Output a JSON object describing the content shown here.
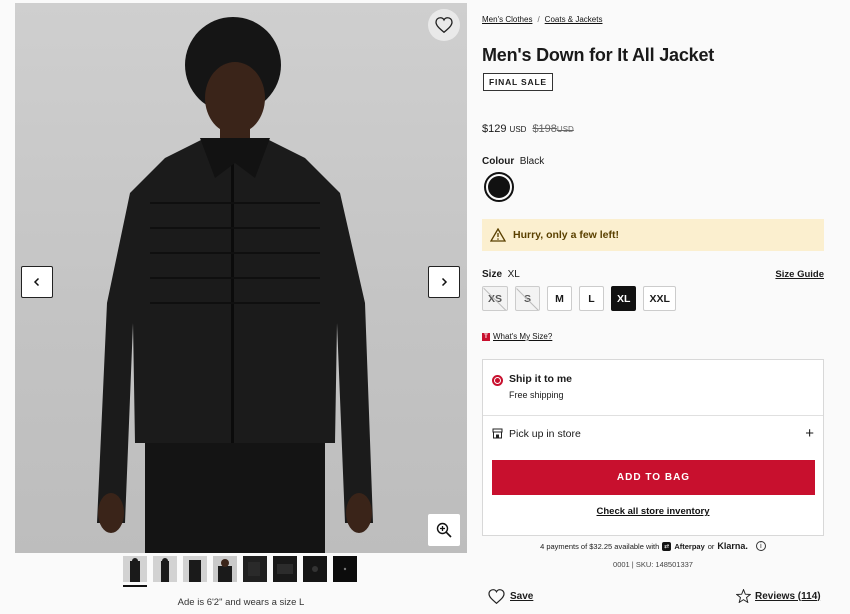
{
  "gallery": {
    "caption": "Ade is 6'2\" and wears a size L",
    "thumbnail_count": 8
  },
  "breadcrumb": [
    "Men's Clothes",
    "Coats & Jackets"
  ],
  "breadcrumb_sep": "/",
  "product": {
    "title": "Men's Down for It All Jacket",
    "badge": "FINAL SALE",
    "price": "$129",
    "price_currency": "USD",
    "original_price": "$198",
    "original_currency": "USD"
  },
  "colour": {
    "label": "Colour",
    "value": "Black",
    "swatch_hex": "#111111"
  },
  "alert": {
    "text": "Hurry, only a few left!"
  },
  "size": {
    "label": "Size",
    "value": "XL",
    "guide_label": "Size Guide",
    "options": [
      {
        "label": "XS",
        "state": "unavailable"
      },
      {
        "label": "S",
        "state": "unavailable"
      },
      {
        "label": "M",
        "state": "available"
      },
      {
        "label": "L",
        "state": "available"
      },
      {
        "label": "XL",
        "state": "selected"
      },
      {
        "label": "XXL",
        "state": "available"
      }
    ],
    "whats_my_size": "What's My Size?",
    "whats_logo": "T"
  },
  "shipping": {
    "ship_title": "Ship it to me",
    "ship_sub": "Free shipping",
    "pickup_label": "Pick up in store",
    "pickup_plus": "+",
    "add_to_bag": "ADD TO BAG",
    "inventory_link": "Check all store inventory"
  },
  "afterpay": {
    "text": "4 payments of $32.25 available with",
    "afterpay_label": "Afterpay",
    "or": "or",
    "klarna": "Klarna.",
    "info": "i"
  },
  "sku": "0001 | SKU: 148501337",
  "actions": {
    "save": "Save",
    "reviews": "Reviews (114)"
  },
  "colors": {
    "accent": "#c8102e",
    "alert_bg": "#fbefcf"
  }
}
